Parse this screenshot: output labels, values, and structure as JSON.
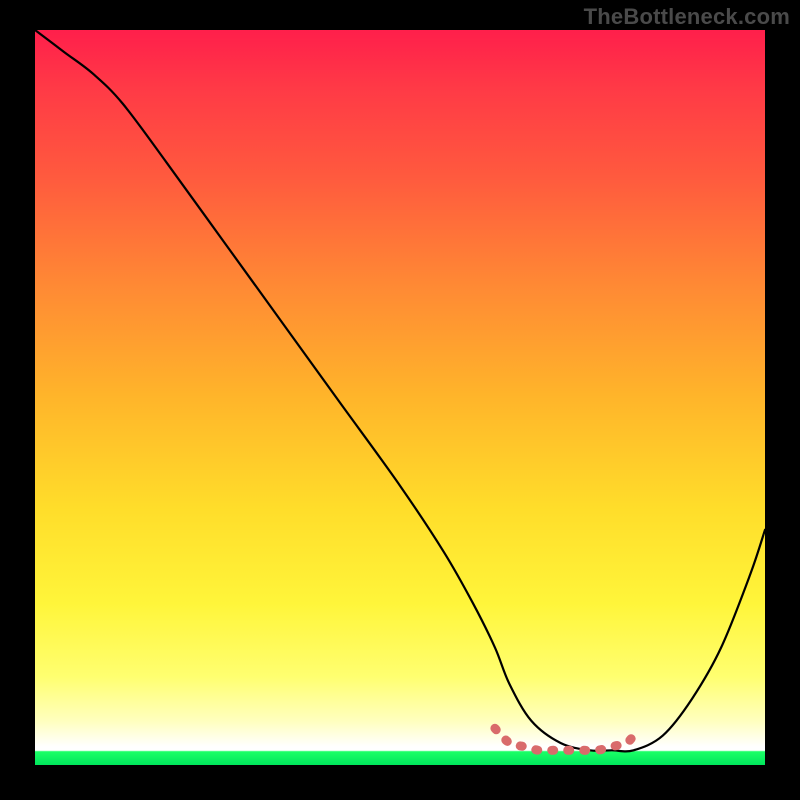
{
  "watermark": "TheBottleneck.com",
  "colors": {
    "background": "#000000",
    "curve": "#000000",
    "marker": "#d96b6b",
    "watermark_text": "#4a4a4a"
  },
  "chart_data": {
    "type": "line",
    "title": "",
    "xlabel": "",
    "ylabel": "",
    "xlim": [
      0,
      100
    ],
    "ylim": [
      0,
      100
    ],
    "grid": false,
    "legend": false,
    "series": [
      {
        "name": "bottleneck-curve",
        "x": [
          0,
          4,
          8,
          12,
          18,
          26,
          34,
          42,
          50,
          56,
          60,
          63,
          65,
          68,
          72,
          76,
          79,
          82,
          86,
          90,
          94,
          98,
          100
        ],
        "values": [
          100,
          97,
          94,
          90,
          82,
          71,
          60,
          49,
          38,
          29,
          22,
          16,
          11,
          6,
          3,
          2,
          2,
          2,
          4,
          9,
          16,
          26,
          32
        ]
      },
      {
        "name": "optimal-range-marker",
        "x": [
          63,
          65,
          67,
          69,
          71,
          73,
          75,
          77,
          79,
          81,
          82
        ],
        "values": [
          5,
          3,
          2.5,
          2,
          2,
          2,
          2,
          2,
          2.5,
          3,
          4
        ]
      }
    ],
    "gradient_stops": [
      {
        "pos": 0,
        "color": "#ff1f4b"
      },
      {
        "pos": 0.35,
        "color": "#ff8a34"
      },
      {
        "pos": 0.65,
        "color": "#ffdd2a"
      },
      {
        "pos": 0.95,
        "color": "#ffffbe"
      },
      {
        "pos": 0.985,
        "color": "#1aff66"
      },
      {
        "pos": 1.0,
        "color": "#00e65c"
      }
    ]
  }
}
